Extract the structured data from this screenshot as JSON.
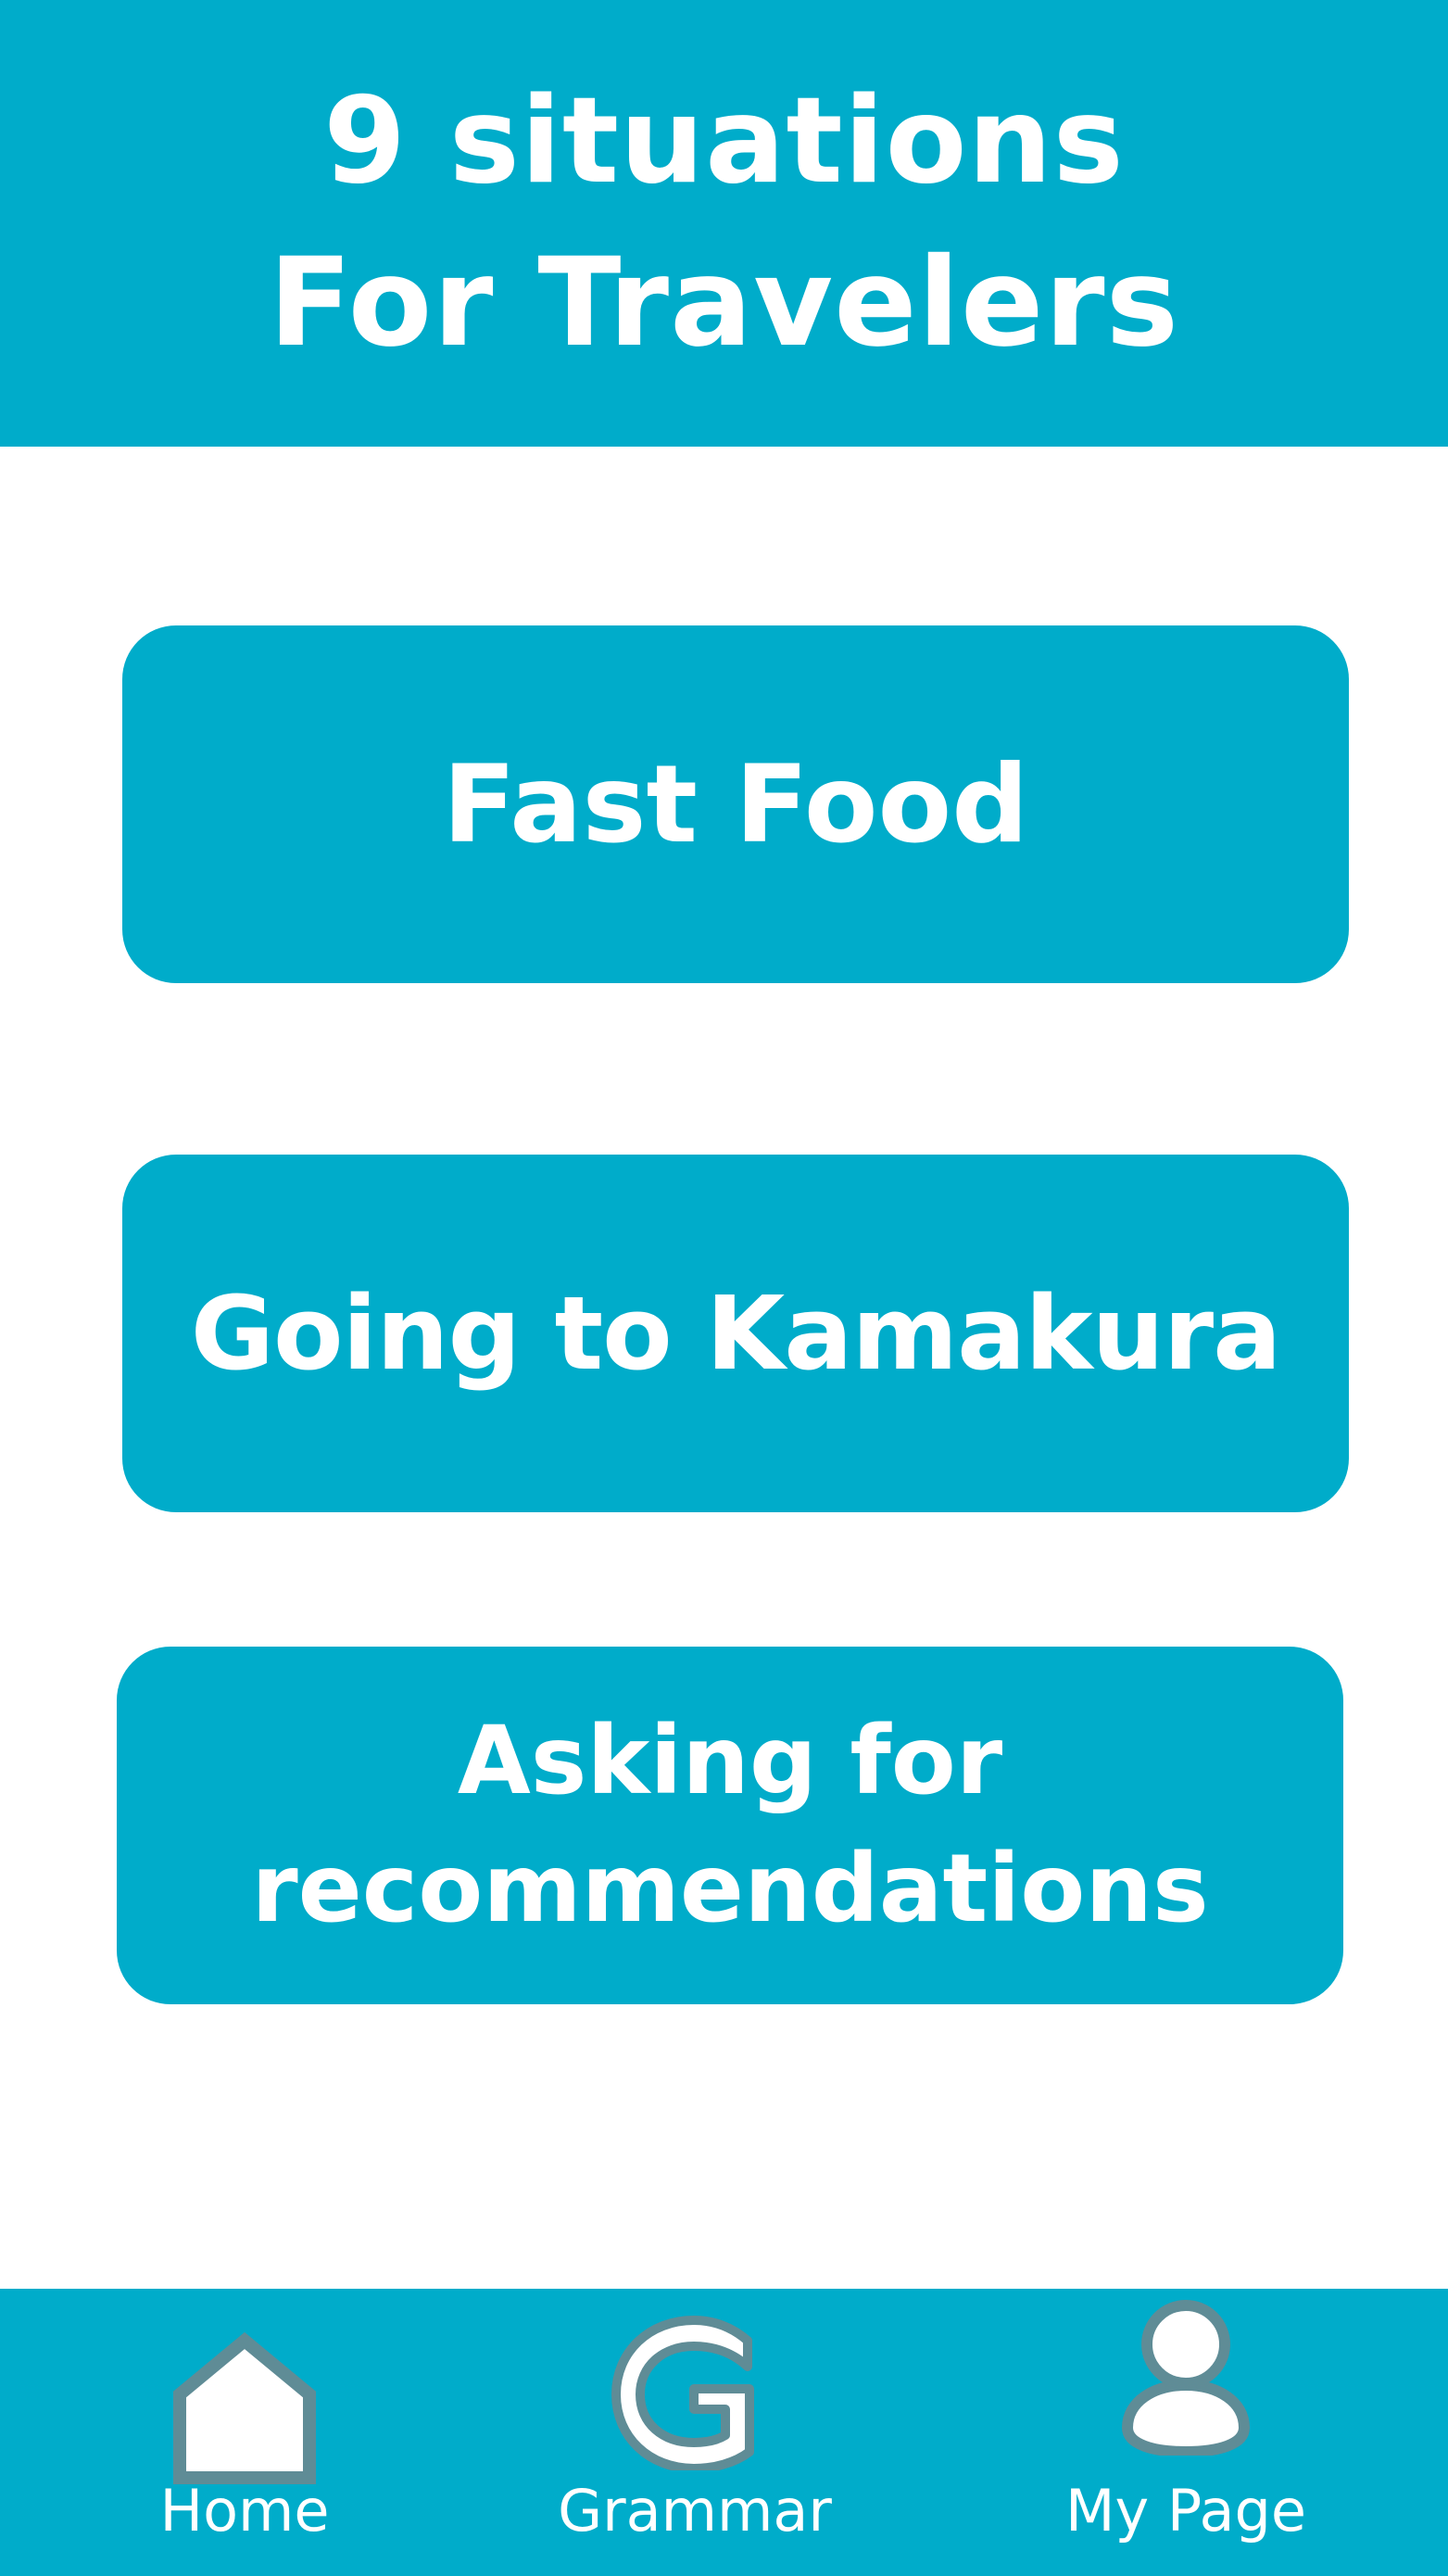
{
  "header": {
    "title_line1": "9 situations",
    "title_line2": "For Travelers"
  },
  "situations": [
    {
      "label": "Fast Food"
    },
    {
      "label": "Going to Kamakura"
    },
    {
      "label_line1": "Asking for",
      "label_line2": "recommendations"
    }
  ],
  "bottom_nav": {
    "items": [
      {
        "label": "Home",
        "icon": "home-icon"
      },
      {
        "label": "Grammar",
        "icon": "grammar-g-icon"
      },
      {
        "label": "My Page",
        "icon": "person-icon"
      }
    ]
  },
  "colors": {
    "accent": "#00acca",
    "icon_outline": "#5f8c96",
    "text": "#ffffff"
  }
}
